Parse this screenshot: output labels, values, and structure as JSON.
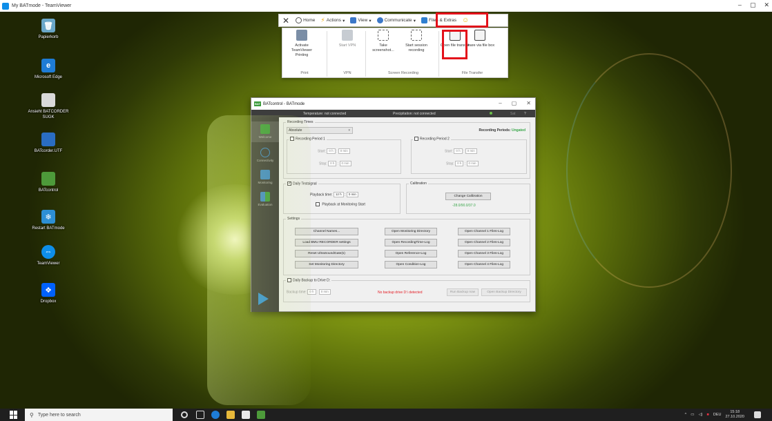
{
  "window": {
    "title": "My BATmode - TeamViewer",
    "controls": [
      "–",
      "▢",
      "✕"
    ]
  },
  "desktop_icons": [
    {
      "label": "Papierkorb",
      "color": "#6aa7c9"
    },
    {
      "label": "Microsoft Edge",
      "color": "#1e7cd6"
    },
    {
      "label": "Ansieht BATCORDER SUGK",
      "color": "#d9d9d9"
    },
    {
      "label": "BATcorder.UTF",
      "color": "#2a6dc2"
    },
    {
      "label": "BATcontrol",
      "color": "#4d9a3a"
    },
    {
      "label": "Restart BATmode",
      "color": "#2d8fd5"
    },
    {
      "label": "TeamViewer",
      "color": "#0e8ee9"
    },
    {
      "label": "Dropbox",
      "color": "#0061fe"
    }
  ],
  "toolbar": {
    "close": "✕",
    "home": "Home",
    "actions": "Actions",
    "view": "View",
    "communicate": "Communicate",
    "files_extras": "Files & Extras",
    "caret": "▾",
    "smiley": "☺"
  },
  "ribbon": {
    "buttons": [
      {
        "label": "Activate TeamViewer Printing",
        "disabled": false
      },
      {
        "label": "Start VPN",
        "disabled": true
      },
      {
        "label": "Take screenshot...",
        "disabled": false
      },
      {
        "label": "Start session recording",
        "disabled": false
      },
      {
        "label": "Open file transfer",
        "disabled": false
      },
      {
        "label": "Share via file box",
        "disabled": false
      }
    ],
    "groups": [
      "Print",
      "VPN",
      "Screen Recording",
      "File Transfer"
    ]
  },
  "bat": {
    "title": "BATcontrol - BATmode",
    "logo": "BAT",
    "status": {
      "temperature": "Temperature: not connected",
      "precipitation": "Precipitation: not connected",
      "signal": "Sat",
      "help": "?"
    },
    "sidebar": [
      "Welcome",
      "Connectivity",
      "Monitoring",
      "Evaluation"
    ],
    "recording_times": {
      "title": "Recording Times",
      "mode": "Absolute",
      "periods_label": "Recording Periods:",
      "periods_value": "Ungated",
      "period1": "Recording Period 1",
      "period2": "Recording Period 2",
      "start": "Start:",
      "stop": "Stop:",
      "h": "0 h",
      "min": "0 min",
      "colon": ":"
    },
    "testsignal": {
      "title": "Daily Testsignal",
      "playback_time": "Playback time:",
      "h": "12 h",
      "min": "0 min",
      "colon": ":",
      "at_start": "Playback at Monitoring Start"
    },
    "calibration": {
      "title": "Calibration",
      "button": "Change Calibration",
      "value": "-28.0/90.0/37.0"
    },
    "settings": {
      "title": "Settings",
      "col1": [
        "Channel Names...",
        "Load BMU RECORDER settings",
        "Reset UltraSoundGate(s)",
        "Set Monitoring Directory"
      ],
      "col2": [
        "Open Monitoring Directory",
        "Open RecordingTime-Log",
        "Open Reference-Log",
        "Open Condition-Log"
      ],
      "col3": [
        "Open Channel 1 Files-Log",
        "Open Channel 2 Files-Log",
        "Open Channel 3 Files-Log",
        "Open Channel 4 Files-Log"
      ]
    },
    "backup": {
      "label": "Daily Backup to Drive D:",
      "time": "Backup time:",
      "h": "0 h",
      "min": "0 min",
      "colon": ":",
      "warning": "No backup drive D:\\ detected",
      "run": "Run Backup now",
      "open": "Open Backup Directory"
    }
  },
  "taskbar": {
    "search_placeholder": "Type here to search",
    "tray_arrow": "^",
    "tray_lang": "DEU",
    "time": "15:18",
    "date": "27.10.2020"
  },
  "colors": {
    "highlight": "#e3101a",
    "accent_green": "#3aa64a",
    "warning_red": "#e31b23"
  }
}
